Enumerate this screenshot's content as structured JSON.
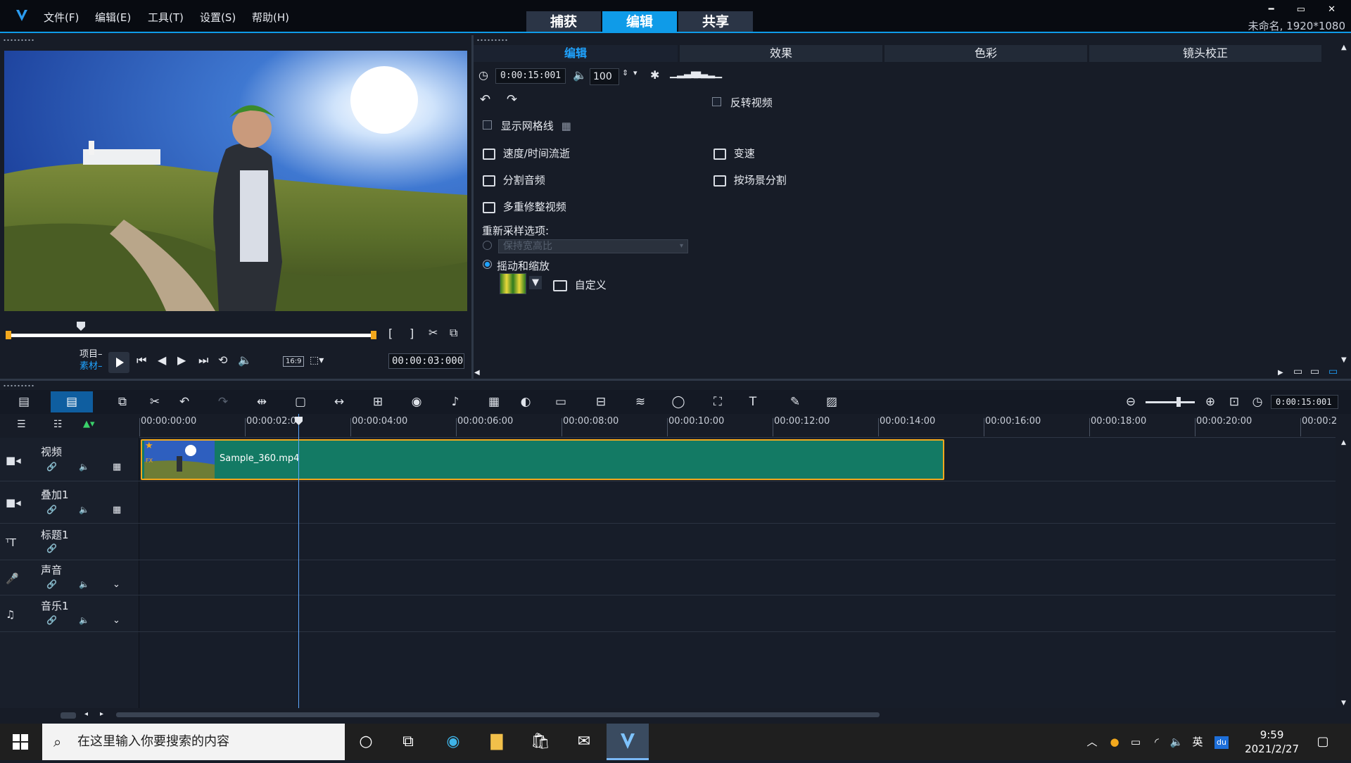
{
  "menu": [
    "文件(F)",
    "编辑(E)",
    "工具(T)",
    "设置(S)",
    "帮助(H)"
  ],
  "workspace_tabs": [
    "捕获",
    "编辑",
    "共享"
  ],
  "window_controls": "━ ▭ ✕",
  "project_info": "未命名, 1920*1080",
  "preview": {
    "mode_project": "项目–",
    "mode_clip": "素材–",
    "timecode": "00:00:03:000",
    "aspect": "16:9"
  },
  "options": {
    "tabs": [
      "编辑",
      "效果",
      "色彩",
      "镜头校正"
    ],
    "duration": "0:00:15:001",
    "volume": "100",
    "reverse_video": "反转视频",
    "show_grid": "显示网格线",
    "speed_time": "速度/时间流逝",
    "speed_change": "变速",
    "split_audio": "分割音频",
    "split_by_scene": "按场景分割",
    "multi_trim": "多重修整视频",
    "resample_label": "重新采样选项:",
    "keep_aspect": "保持宽高比",
    "pan_zoom": "摇动和缩放",
    "customize": "自定义"
  },
  "timeline": {
    "timecode": "0:00:15:001",
    "ruler": [
      "00:00:00:00",
      "00:00:02:00",
      "00:00:04:00",
      "00:00:06:00",
      "00:00:08:00",
      "00:00:10:00",
      "00:00:12:00",
      "00:00:14:00",
      "00:00:16:00",
      "00:00:18:00",
      "00:00:20:00",
      "00:00:2"
    ],
    "tracks": [
      "视频",
      "叠加1",
      "标题1",
      "声音",
      "音乐1"
    ],
    "clip_name": "Sample_360.mp4"
  },
  "taskbar": {
    "search_placeholder": "在这里输入你要搜索的内容",
    "ime": "英",
    "time": "9:59",
    "date": "2021/2/27"
  }
}
